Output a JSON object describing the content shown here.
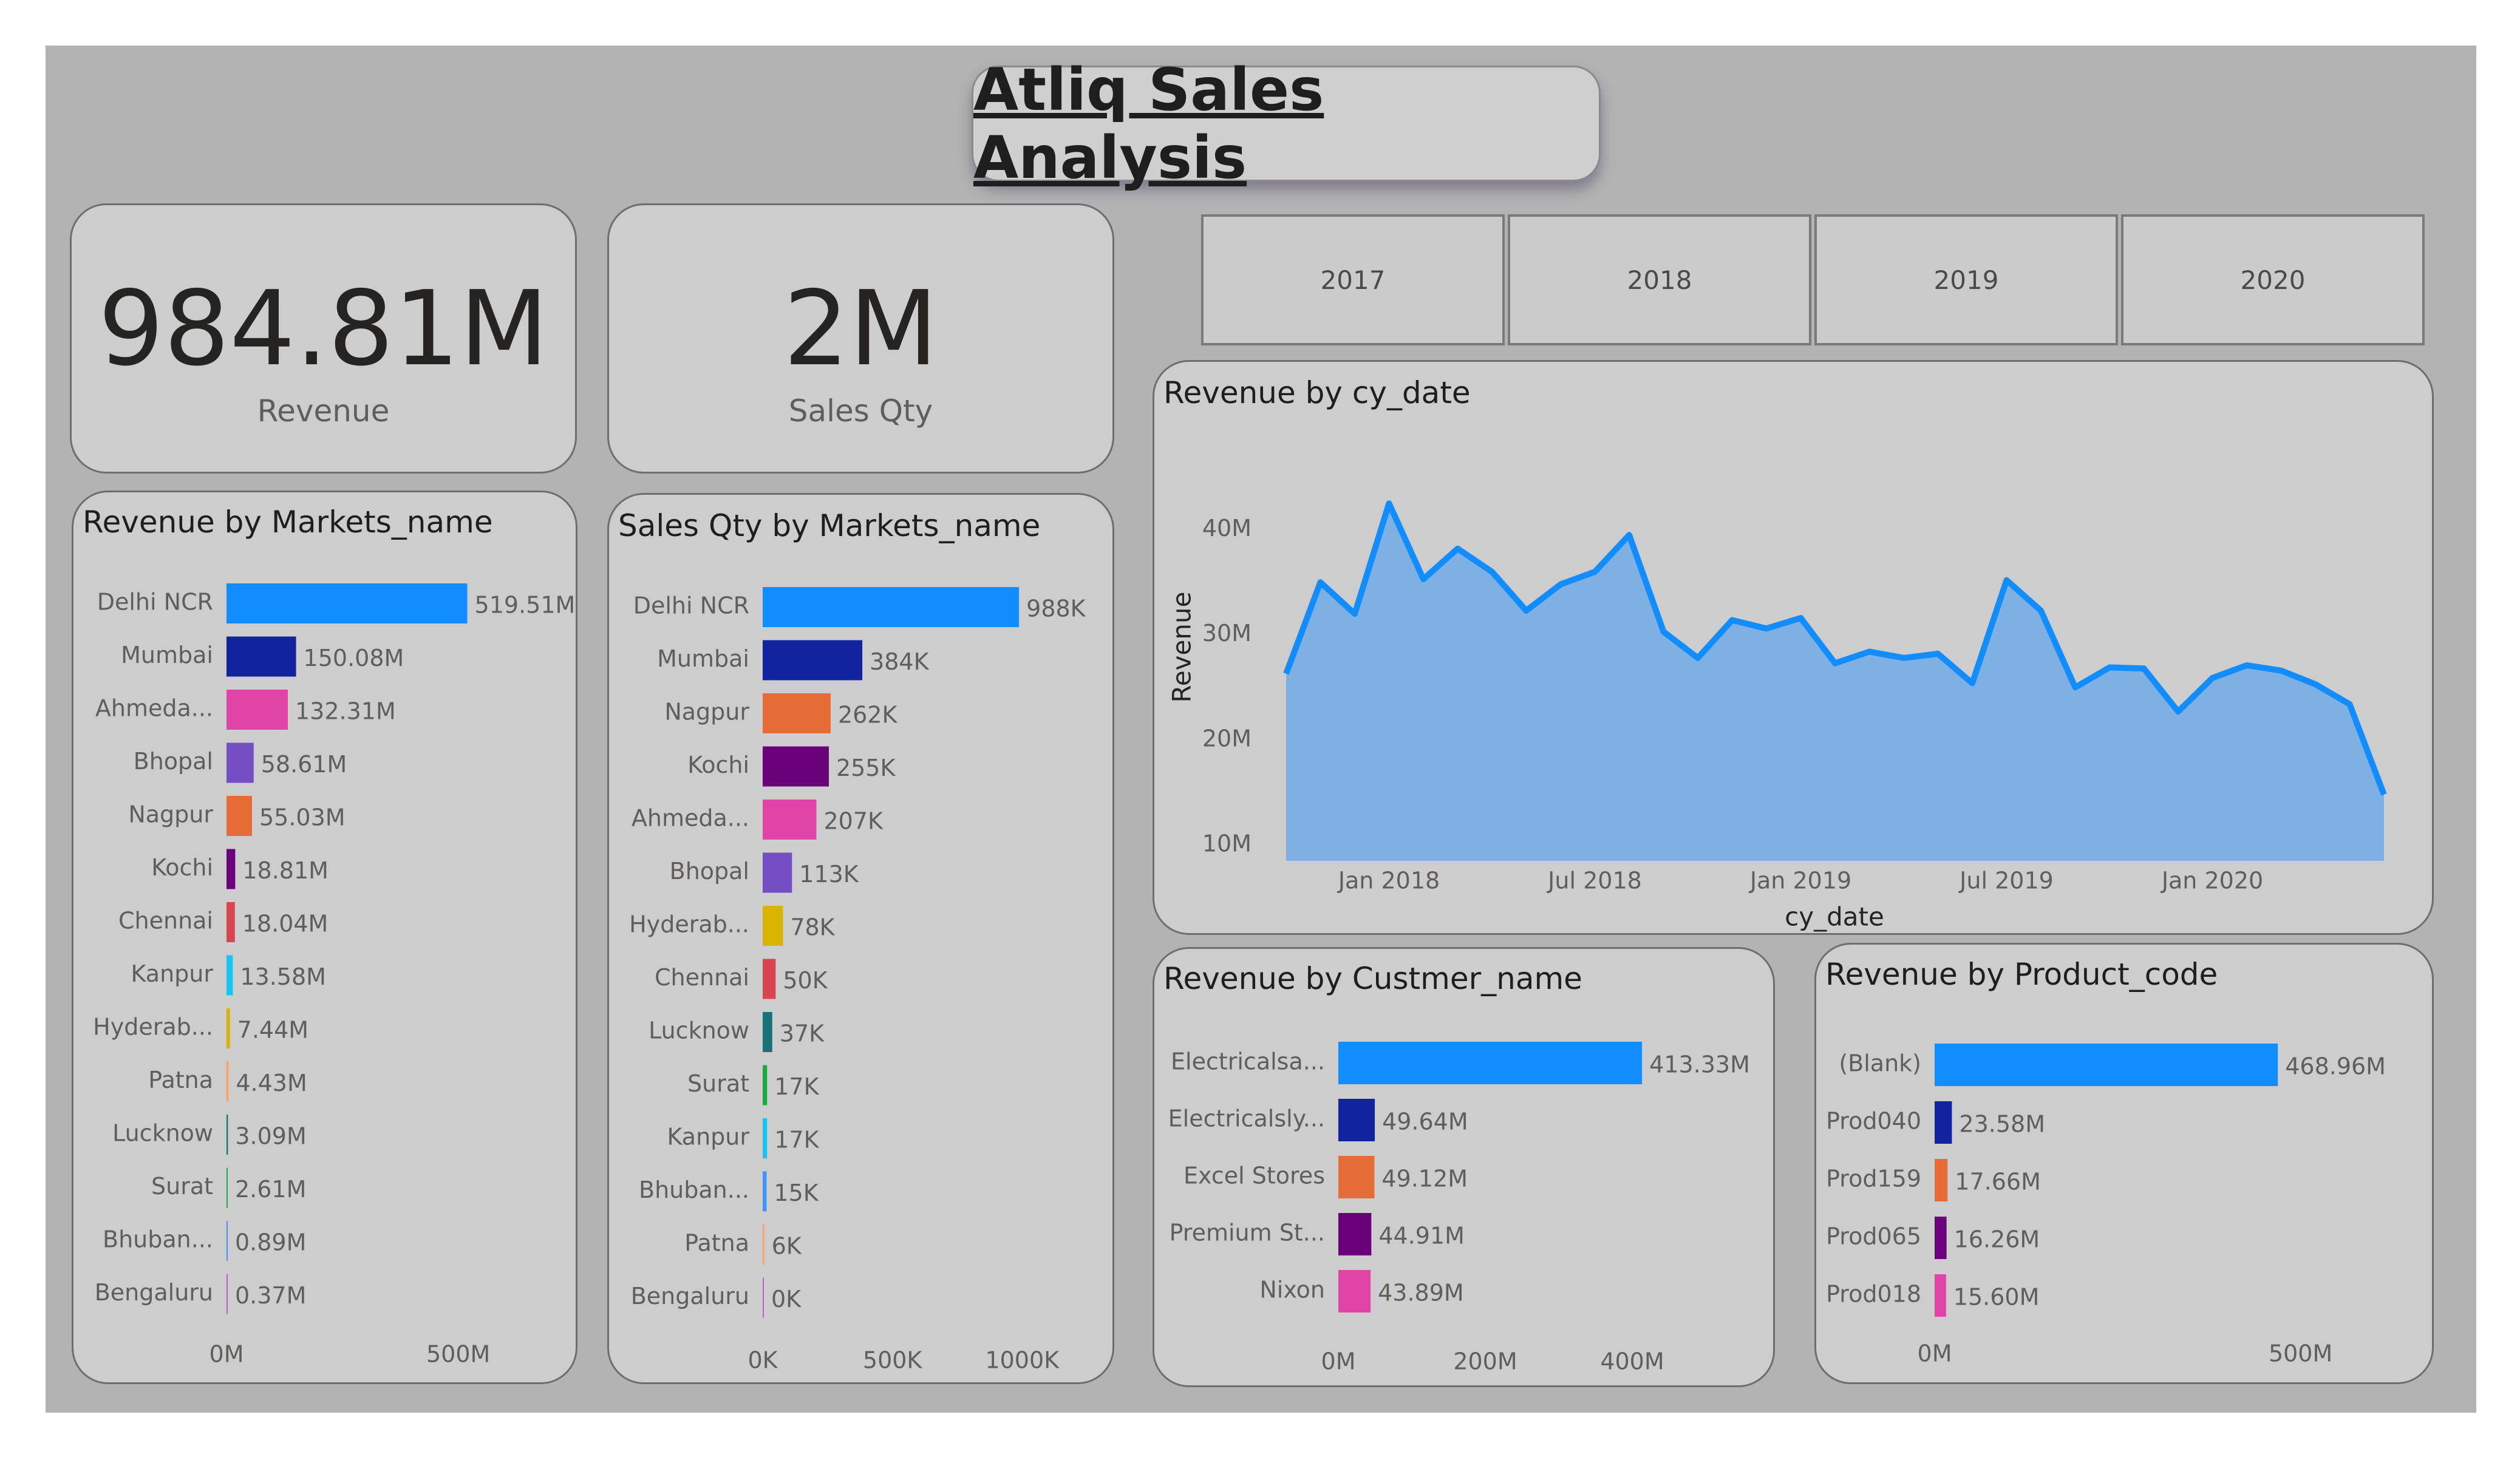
{
  "header": {
    "title": "Atliq Sales Analysis"
  },
  "kpis": [
    {
      "value": "984.81M",
      "label": "Revenue"
    },
    {
      "value": "2M",
      "label": "Sales Qty"
    }
  ],
  "slicer": {
    "years": [
      "2017",
      "2018",
      "2019",
      "2020"
    ]
  },
  "colors": {
    "palette": [
      "#118DFF",
      "#12239E",
      "#E66C37",
      "#6B007B",
      "#E044A7",
      "#744EC2",
      "#D9B300",
      "#D64550",
      "#197278",
      "#1AAB40",
      "#15C6F4",
      "#4092FF",
      "#FFA058",
      "#BE5DC9"
    ],
    "area_fill": "#7fb0e3",
    "area_line": "#118DFF"
  },
  "chart_data": [
    {
      "type": "bar",
      "title": "Revenue by Markets_name",
      "categories": [
        "Delhi NCR",
        "Mumbai",
        "Ahmeda...",
        "Bhopal",
        "Nagpur",
        "Kochi",
        "Chennai",
        "Kanpur",
        "Hyderab...",
        "Patna",
        "Lucknow",
        "Surat",
        "Bhuban...",
        "Bengaluru"
      ],
      "values": [
        519.51,
        150.08,
        132.31,
        58.61,
        55.03,
        18.81,
        18.04,
        13.58,
        7.44,
        4.43,
        3.09,
        2.61,
        0.89,
        0.37
      ],
      "value_labels": [
        "519.51M",
        "150.08M",
        "132.31M",
        "58.61M",
        "55.03M",
        "18.81M",
        "18.04M",
        "13.58M",
        "7.44M",
        "4.43M",
        "3.09M",
        "2.61M",
        "0.89M",
        "0.37M"
      ],
      "colors": [
        "#118DFF",
        "#12239E",
        "#E044A7",
        "#744EC2",
        "#E66C37",
        "#6B007B",
        "#D64550",
        "#15C6F4",
        "#D9B300",
        "#FFA058",
        "#197278",
        "#1AAB40",
        "#4092FF",
        "#BE5DC9"
      ],
      "xlim": [
        0,
        600
      ],
      "x_ticks": [
        0,
        500
      ],
      "x_tick_labels": [
        "0M",
        "500M"
      ]
    },
    {
      "type": "bar",
      "title": "Sales Qty by Markets_name",
      "categories": [
        "Delhi NCR",
        "Mumbai",
        "Nagpur",
        "Kochi",
        "Ahmeda...",
        "Bhopal",
        "Hyderab...",
        "Chennai",
        "Lucknow",
        "Surat",
        "Kanpur",
        "Bhuban...",
        "Patna",
        "Bengaluru"
      ],
      "values": [
        988,
        384,
        262,
        255,
        207,
        113,
        78,
        50,
        37,
        17,
        17,
        15,
        6,
        0
      ],
      "value_labels": [
        "988K",
        "384K",
        "262K",
        "255K",
        "207K",
        "113K",
        "78K",
        "50K",
        "37K",
        "17K",
        "17K",
        "15K",
        "6K",
        "0K"
      ],
      "colors": [
        "#118DFF",
        "#12239E",
        "#E66C37",
        "#6B007B",
        "#E044A7",
        "#744EC2",
        "#D9B300",
        "#D64550",
        "#197278",
        "#1AAB40",
        "#15C6F4",
        "#4092FF",
        "#FFA058",
        "#BE5DC9"
      ],
      "xlim": [
        0,
        1100
      ],
      "x_ticks": [
        0,
        500,
        1000
      ],
      "x_tick_labels": [
        "0K",
        "500K",
        "1000K"
      ]
    },
    {
      "type": "area",
      "title": "Revenue by cy_date",
      "xlabel": "cy_date",
      "ylabel": "Revenue",
      "x": [
        "2017-10",
        "2017-11",
        "2017-12",
        "2018-01",
        "2018-02",
        "2018-03",
        "2018-04",
        "2018-05",
        "2018-06",
        "2018-07",
        "2018-08",
        "2018-09",
        "2018-10",
        "2018-11",
        "2018-12",
        "2019-01",
        "2019-02",
        "2019-03",
        "2019-04",
        "2019-05",
        "2019-06",
        "2019-07",
        "2019-08",
        "2019-09",
        "2019-10",
        "2019-11",
        "2019-12",
        "2020-01",
        "2020-02",
        "2020-03",
        "2020-04",
        "2020-05",
        "2020-06"
      ],
      "values": [
        26.3,
        35.0,
        32.0,
        42.5,
        35.3,
        38.2,
        36.0,
        32.3,
        34.8,
        36.0,
        39.5,
        30.3,
        27.8,
        31.4,
        30.6,
        31.6,
        27.3,
        28.4,
        27.8,
        28.2,
        25.4,
        35.2,
        32.3,
        25.0,
        26.9,
        26.8,
        22.7,
        25.9,
        27.1,
        26.6,
        25.3,
        23.4,
        14.8
      ],
      "ylim": [
        8.5,
        45
      ],
      "y_ticks": [
        10,
        20,
        30,
        40
      ],
      "y_tick_labels": [
        "10M",
        "20M",
        "30M",
        "40M"
      ],
      "x_ticks": [
        "2018-01",
        "2018-07",
        "2019-01",
        "2019-07",
        "2020-01"
      ],
      "x_tick_labels": [
        "Jan 2018",
        "Jul 2018",
        "Jan 2019",
        "Jul 2019",
        "Jan 2020"
      ]
    },
    {
      "type": "bar",
      "title": "Revenue by Custmer_name",
      "categories": [
        "Electricalsa...",
        "Electricalsly...",
        "Excel Stores",
        "Premium St...",
        "Nixon"
      ],
      "values": [
        413.33,
        49.64,
        49.12,
        44.91,
        43.89
      ],
      "value_labels": [
        "413.33M",
        "49.64M",
        "49.12M",
        "44.91M",
        "43.89M"
      ],
      "colors": [
        "#118DFF",
        "#12239E",
        "#E66C37",
        "#6B007B",
        "#E044A7"
      ],
      "xlim": [
        0,
        500
      ],
      "x_ticks": [
        0,
        200,
        400
      ],
      "x_tick_labels": [
        "0M",
        "200M",
        "400M"
      ]
    },
    {
      "type": "bar",
      "title": "Revenue by Product_code",
      "categories": [
        "(Blank)",
        "Prod040",
        "Prod159",
        "Prod065",
        "Prod018"
      ],
      "values": [
        468.96,
        23.58,
        17.66,
        16.26,
        15.6
      ],
      "value_labels": [
        "468.96M",
        "23.58M",
        "17.66M",
        "16.26M",
        "15.60M"
      ],
      "colors": [
        "#118DFF",
        "#12239E",
        "#E66C37",
        "#6B007B",
        "#E044A7"
      ],
      "xlim": [
        0,
        570
      ],
      "x_ticks": [
        0,
        500
      ],
      "x_tick_labels": [
        "0M",
        "500M"
      ]
    }
  ]
}
